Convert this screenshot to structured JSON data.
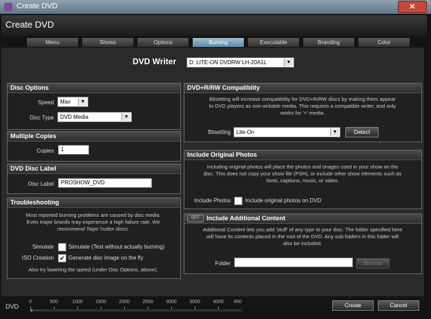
{
  "window": {
    "title": "Create DVD",
    "close_label": "✕"
  },
  "header": {
    "title": "Create DVD"
  },
  "tabs": [
    "Menu",
    "Shows",
    "Options",
    "Burning",
    "Executable",
    "Branding",
    "Color"
  ],
  "active_tab": "Burning",
  "dvd_writer": {
    "label": "DVD Writer",
    "value": "D: LITE-ON DVDRW LH-20A1L"
  },
  "disc_options": {
    "title": "Disc Options",
    "speed_label": "Speed",
    "speed_value": "Max",
    "disc_type_label": "Disc Type",
    "disc_type_value": "DVD Media"
  },
  "multiple_copies": {
    "title": "Multiple Copies",
    "copies_label": "Copies",
    "copies_value": "1"
  },
  "dvd_disc_label": {
    "title": "DVD Disc Label",
    "label": "Disc Label",
    "value": "PROSHOW_DVD"
  },
  "troubleshooting": {
    "title": "Troubleshooting",
    "desc1": "Most reported burning problems are caused by disc media.",
    "desc2": "Even major brands may experience a high failure rate. We",
    "desc3": "recommend Taiyo Yuden discs.",
    "simulate_label": "Simulate",
    "simulate_text": "Simulate (Test without actually burning)",
    "iso_label": "ISO Creation",
    "iso_text": "Generate disc image on the fly",
    "hint": "Also try lowering the speed (under Disc Options, above)."
  },
  "compatibility": {
    "title": "DVD+R/RW Compatiblity",
    "desc1": "Bitsetting will increase compatibility for DVD+R/RW discs by making them appear",
    "desc2": "to DVD players as non-writable media. This requires a compatible writer, and only",
    "desc3": "works for '+' media.",
    "bitsetting_label": "Bitsetting",
    "bitsetting_value": "Lite-On",
    "detect_label": "Detect"
  },
  "original_photos": {
    "title": "Include Original Photos",
    "desc1": "Including original photos will place the photos and images used in your show on the",
    "desc2": "disc. This does not copy your show file (PSH), or include other show elements such as",
    "desc3": "fonts, captions, music, or video.",
    "include_label": "Include Photos",
    "include_text": "Include original photos on DVD"
  },
  "additional_content": {
    "toggle_label": "OFF",
    "title": "Include Additional Content",
    "desc1": "Additional Content lets you add 'stuff' of any type to your disc. The folder specified here",
    "desc2": "will have its contents placed in the root of the DVD. Any sub-folders in this folder will",
    "desc3": "also be included.",
    "folder_label": "Folder",
    "folder_value": "",
    "browse_label": "Browse"
  },
  "footer": {
    "meter_label": "DVD",
    "ticks": [
      "0",
      "500",
      "1000",
      "1500",
      "2000",
      "2500",
      "3000",
      "3500",
      "4000",
      "450"
    ],
    "fill_fraction": 0.01,
    "create_label": "Create",
    "cancel_label": "Cancel"
  }
}
